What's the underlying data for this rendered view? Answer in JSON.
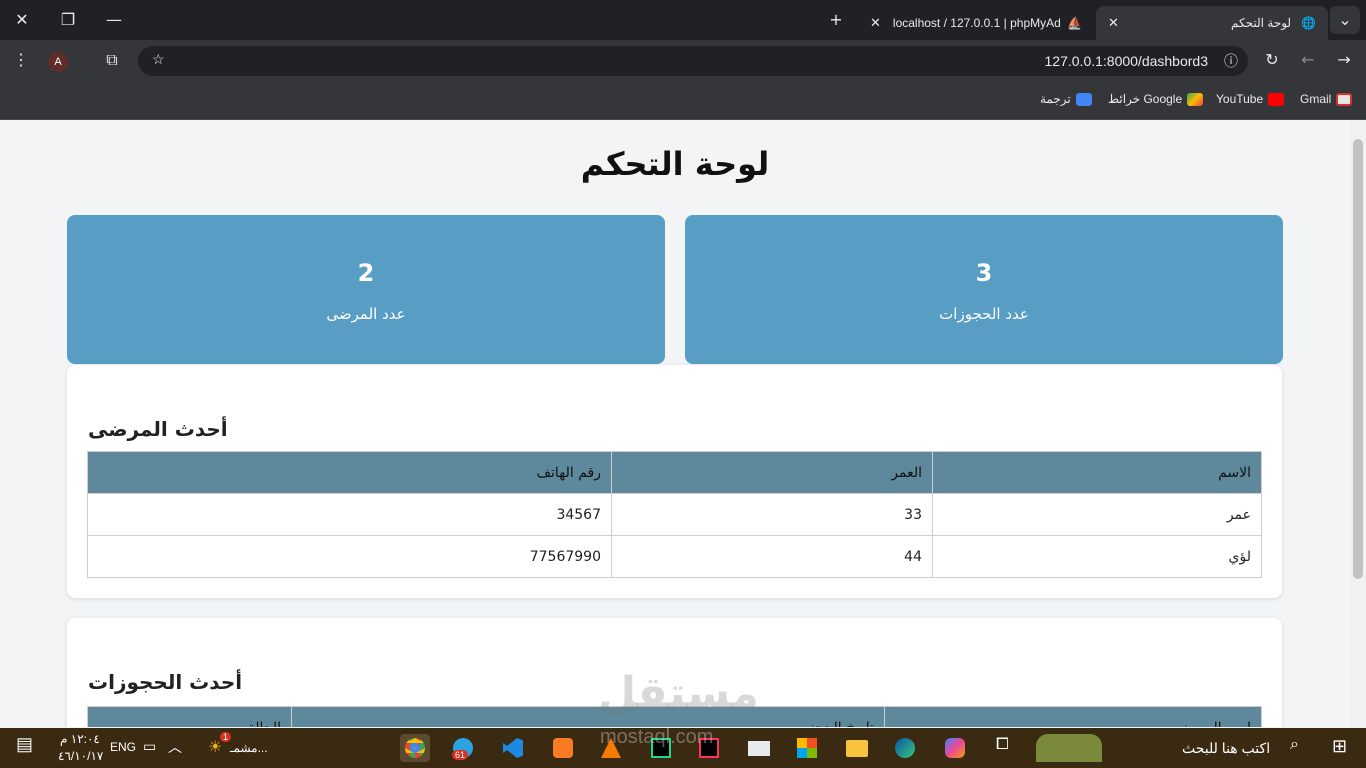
{
  "browser": {
    "tabs": [
      {
        "title": "لوحة التحكم",
        "active": true
      },
      {
        "title": "localhost / 127.0.0.1 | phpMyAd",
        "active": false
      }
    ],
    "url": "127.0.0.1:8000/dashbord3",
    "profile_initial": "A",
    "bookmarks": [
      "Gmail",
      "YouTube",
      "خرائط Google",
      "ترجمة"
    ]
  },
  "page": {
    "title": "لوحة التحكم",
    "stats": [
      {
        "value": "3",
        "label": "عدد الحجوزات"
      },
      {
        "value": "2",
        "label": "عدد المرضى"
      }
    ],
    "patients": {
      "heading": "أحدث المرضى",
      "columns": [
        "الاسم",
        "العمر",
        "رقم الهاتف"
      ],
      "rows": [
        [
          "عمر",
          "33",
          "34567"
        ],
        [
          "لؤي",
          "44",
          "77567990"
        ]
      ]
    },
    "bookings": {
      "heading": "أحدث الحجوزات",
      "columns": [
        "اسم المريض",
        "تاريخ الحجز",
        "الحالة"
      ]
    }
  },
  "taskbar": {
    "search_placeholder": "اكتب هنا للبحث",
    "weather": "مشمـ...",
    "weather_badge": "1",
    "telegram_badge": "61",
    "language": "ENG",
    "time": "١٢:٠٤ م",
    "date": "٤٦/١٠/١٧"
  },
  "watermark": {
    "text": "مستقل",
    "url": "mostaql.com"
  },
  "colors": {
    "stat_card": "#589dc4",
    "table_header": "#5e889c",
    "taskbar": "#3b2a12"
  }
}
